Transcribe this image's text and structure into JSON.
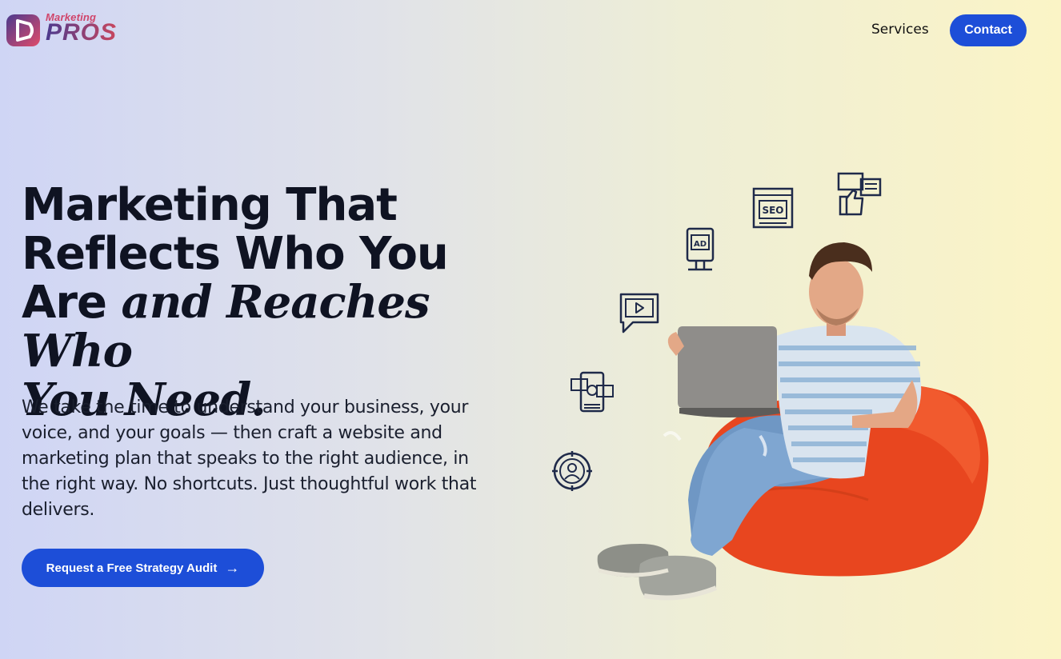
{
  "brand": {
    "top": "Marketing",
    "main": "PROS",
    "colors": {
      "primary": "#1d4ed8",
      "logo_pink": "#d0456b",
      "logo_purple": "#4b3a8e"
    }
  },
  "nav": {
    "services": "Services",
    "contact": "Contact"
  },
  "hero": {
    "title_line1": "Marketing That",
    "title_line2": "Reflects Who You",
    "title_line3_plain": "Are ",
    "title_line3_italic": "and Reaches Who",
    "title_line4_italic": "You Need.",
    "description": "We take the time to understand your business, your voice, and your goals — then craft a website and marketing plan that speaks to the right audience, in the right way. No shortcuts. Just thoughtful work that delivers.",
    "cta_label": "Request a Free Strategy Audit",
    "cta_icon": "arrow-right-icon"
  },
  "illustration": {
    "icons": [
      "seo-icon",
      "thumbs-up-chat-icon",
      "ad-billboard-icon",
      "video-play-icon",
      "social-media-icon",
      "target-user-icon"
    ],
    "seo_label": "SEO",
    "ad_label": "AD"
  }
}
